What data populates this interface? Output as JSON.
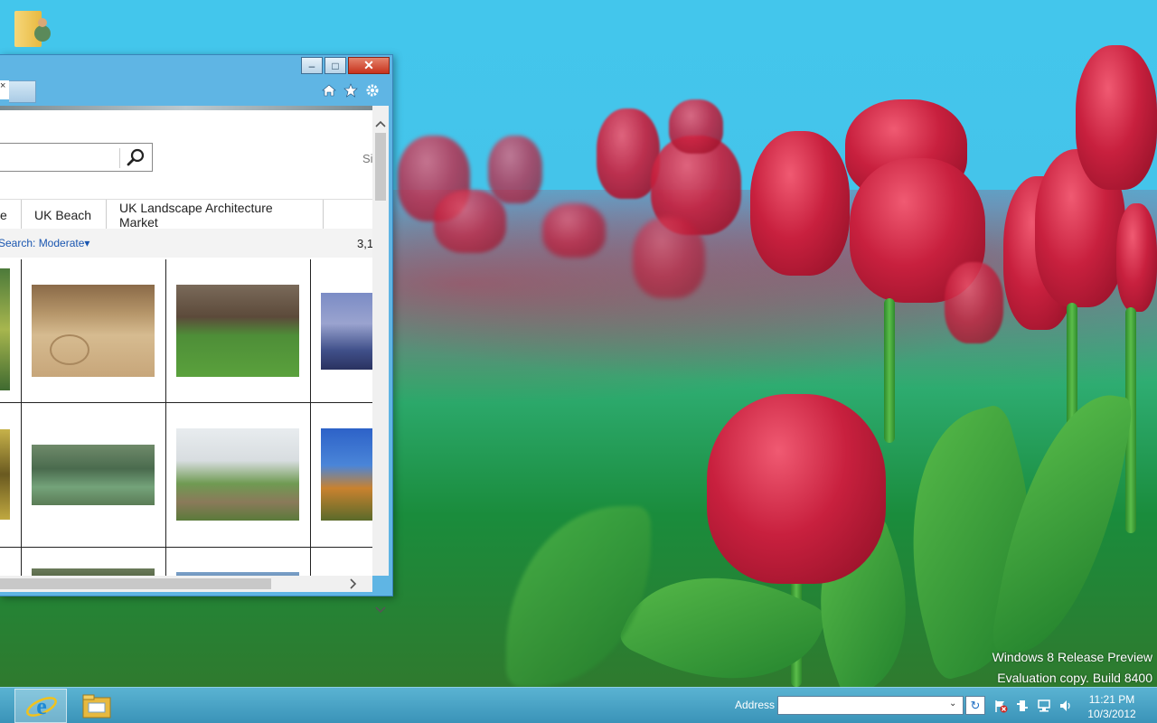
{
  "desktop": {
    "icon_label": "",
    "watermark": {
      "line1": "Windows 8 Release Preview",
      "line2": "Evaluation copy. Build 8400"
    }
  },
  "window": {
    "controls": {
      "minimize": "–",
      "maximize": "□",
      "close": "✕"
    },
    "tab": {
      "close_glyph": "×"
    },
    "toolbar_icons": [
      "home-icon",
      "star-icon",
      "gear-icon"
    ],
    "search": {
      "value": "",
      "placeholder": ""
    },
    "sign_in_fragment": "Si",
    "category_tabs": [
      {
        "label": "e"
      },
      {
        "label": "UK Beach"
      },
      {
        "label": "UK Landscape Architecture Market"
      }
    ],
    "filter": {
      "label": "Search: Moderate",
      "dropdown_glyph": "▾"
    },
    "result_count_fragment": "3,1"
  },
  "taskbar": {
    "items": [
      "internet-explorer-icon",
      "file-explorer-icon"
    ],
    "address": {
      "label": "Address",
      "value": "",
      "dropdown_glyph": "⌄"
    },
    "refresh_glyph": "↻",
    "tray_icons": [
      "action-center-flag-icon",
      "power-icon",
      "network-icon",
      "volume-icon"
    ],
    "clock": {
      "time": "11:21 PM",
      "date": "10/3/2012"
    }
  },
  "colors": {
    "taskbar": "#3a93b8",
    "window_frame": "#5fb5e4",
    "close_button": "#c7321c",
    "link_blue": "#1a56b0"
  }
}
